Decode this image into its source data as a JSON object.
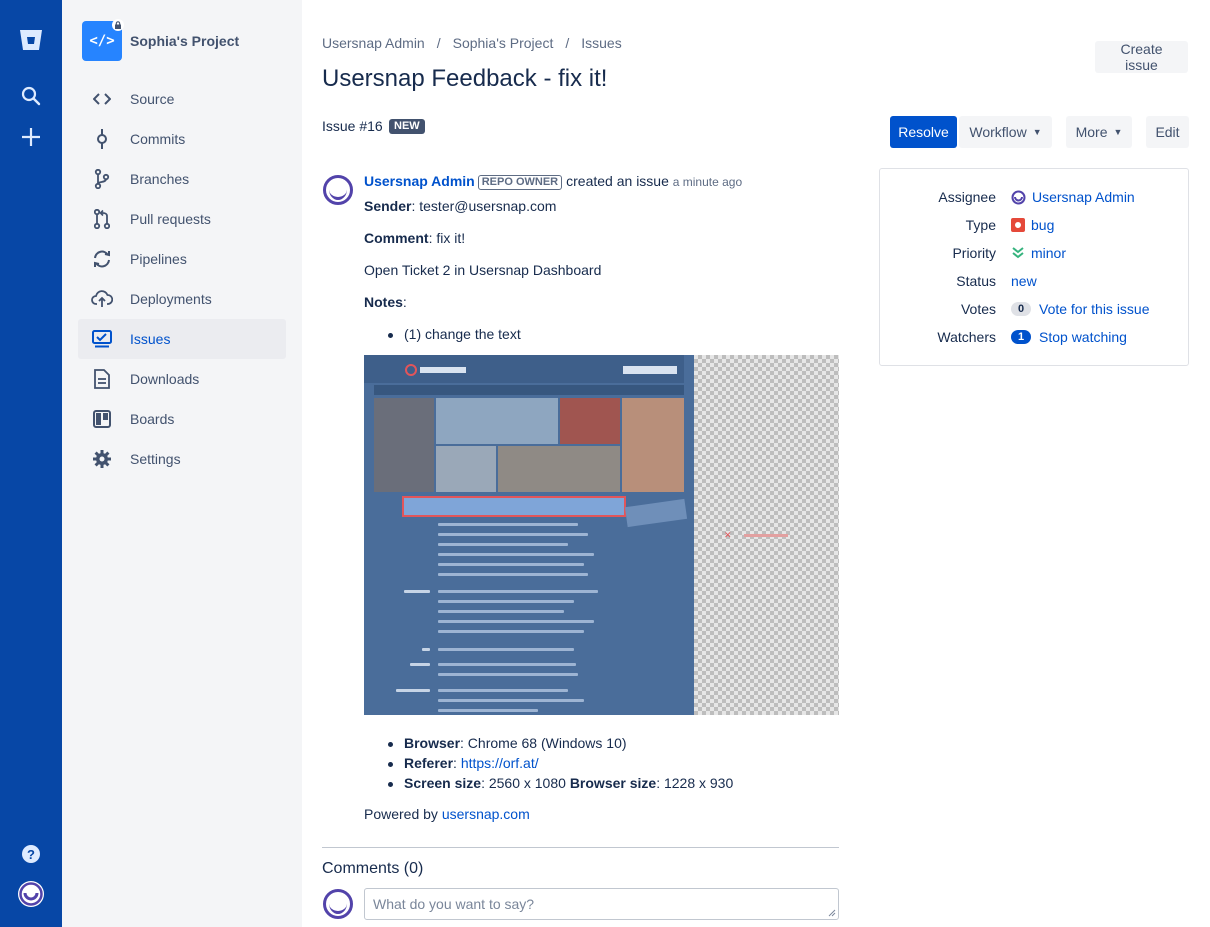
{
  "sidebar": {
    "project_name": "Sophia's Project",
    "project_avatar_glyph": "</>",
    "items": [
      {
        "label": "Source",
        "icon": "code-icon"
      },
      {
        "label": "Commits",
        "icon": "commit-icon"
      },
      {
        "label": "Branches",
        "icon": "branch-icon"
      },
      {
        "label": "Pull requests",
        "icon": "pull-request-icon"
      },
      {
        "label": "Pipelines",
        "icon": "pipelines-icon"
      },
      {
        "label": "Deployments",
        "icon": "deployments-icon"
      },
      {
        "label": "Issues",
        "icon": "issues-icon",
        "active": true
      },
      {
        "label": "Downloads",
        "icon": "downloads-icon"
      },
      {
        "label": "Boards",
        "icon": "boards-icon"
      },
      {
        "label": "Settings",
        "icon": "settings-icon"
      }
    ]
  },
  "breadcrumb": [
    "Usersnap Admin",
    "Sophia's Project",
    "Issues"
  ],
  "breadcrumb_separator": "/",
  "header": {
    "title": "Usersnap Feedback - fix it!",
    "create_issue_label": "Create issue"
  },
  "toolbar": {
    "resolve_label": "Resolve",
    "workflow_label": "Workflow",
    "more_label": "More",
    "edit_label": "Edit"
  },
  "issue": {
    "number_label": "Issue #16",
    "status_badge": "NEW",
    "author": "Usersnap Admin",
    "author_role": "REPO OWNER",
    "action_text": "created an issue",
    "time": "a minute ago",
    "sender_label": "Sender",
    "sender_value": ": tester@usersnap.com",
    "comment_label": "Comment",
    "comment_value": ": fix it!",
    "dashboard_link": "Open Ticket 2 in Usersnap Dashboard",
    "notes_label": "Notes",
    "notes_colon": ":",
    "notes": [
      "(1) change the text"
    ],
    "browser_label": "Browser",
    "browser_value": ": Chrome 68 (Windows 10)",
    "referer_label": "Referer",
    "referer_colon": ": ",
    "referer_value": "https://orf.at/",
    "screen_label": "Screen size",
    "screen_value": ": 2560 x 1080 ",
    "browser_size_label": "Browser size",
    "browser_size_value": ": 1228 x 930",
    "powered_prefix": "Powered by ",
    "powered_link": "usersnap.com"
  },
  "details": {
    "assignee_label": "Assignee",
    "assignee_value": "Usersnap Admin",
    "type_label": "Type",
    "type_value": "bug",
    "priority_label": "Priority",
    "priority_value": "minor",
    "status_label": "Status",
    "status_value": "new",
    "votes_label": "Votes",
    "votes_count": "0",
    "votes_link": "Vote for this issue",
    "watchers_label": "Watchers",
    "watchers_count": "1",
    "watchers_link": "Stop watching"
  },
  "comments": {
    "title": "Comments (0)",
    "placeholder": "What do you want to say?"
  },
  "colors": {
    "nav_bg": "#0747a6",
    "primary": "#0052cc",
    "sidebar_bg": "#f4f5f7",
    "bug_red": "#e5493a",
    "minor_green": "#36b37e",
    "usersnap_purple": "#5243aa"
  }
}
